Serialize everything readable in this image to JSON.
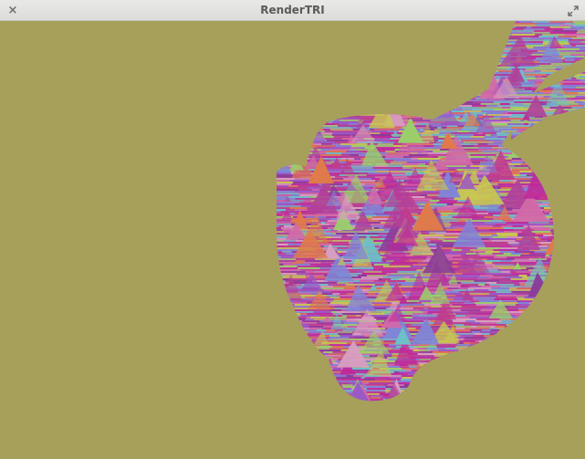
{
  "window": {
    "title": "RenderTRI",
    "close_glyph": "×",
    "close_icon": "close-icon",
    "maximize_icon": "maximize-icon"
  },
  "viewport": {
    "background_color": "#a6a05b",
    "mesh_palette": [
      "#c03c8c",
      "#b0409a",
      "#d26aa8",
      "#9a55c8",
      "#7f86d8",
      "#6cc0c8",
      "#9ad06a",
      "#c8c850",
      "#e07a4a",
      "#c0289a",
      "#8a3a9a",
      "#d8a0c0"
    ]
  }
}
